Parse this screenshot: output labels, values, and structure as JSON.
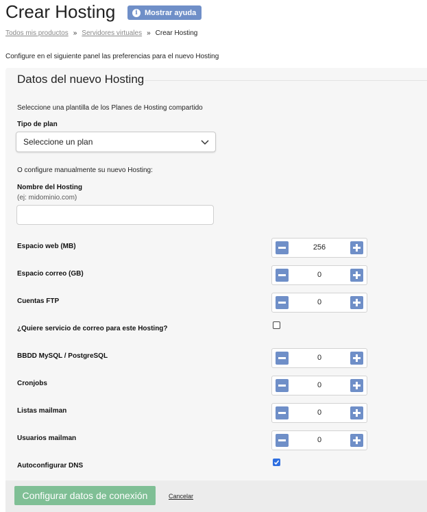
{
  "header": {
    "title": "Crear Hosting",
    "help_button": "Mostrar ayuda"
  },
  "breadcrumb": {
    "items": [
      "Todos mis productos",
      "Servidores virtuales",
      "Crear Hosting"
    ],
    "separator": "»"
  },
  "intro": "Configure en el siguiente panel las preferencias para el nuevo Hosting",
  "panel": {
    "title": "Datos del nuevo Hosting",
    "template_hint": "Seleccione una plantilla de los Planes de Hosting compartido",
    "plan_label": "Tipo de plan",
    "plan_select_value": "Seleccione un plan",
    "manual_hint": "O configure manualmente su nuevo Hosting:",
    "hosting_name_label": "Nombre del Hosting",
    "hosting_name_example": "(ej: midominio.com)",
    "hosting_name_value": ""
  },
  "fields": {
    "web_space": {
      "label": "Espacio web (MB)",
      "value": "256"
    },
    "mail_space": {
      "label": "Espacio correo (GB)",
      "value": "0"
    },
    "ftp_accounts": {
      "label": "Cuentas FTP",
      "value": "0"
    },
    "mail_service": {
      "label": "¿Quiere servicio de correo para este Hosting?",
      "checked": false
    },
    "databases": {
      "label": "BBDD MySQL / PostgreSQL",
      "value": "0"
    },
    "cronjobs": {
      "label": "Cronjobs",
      "value": "0"
    },
    "mailman_lists": {
      "label": "Listas mailman",
      "value": "0"
    },
    "mailman_users": {
      "label": "Usuarios mailman",
      "value": "0"
    },
    "auto_dns": {
      "label": "Autoconfigurar DNS",
      "checked": true
    }
  },
  "actions": {
    "submit": "Configurar datos de conexión",
    "cancel": "Cancelar"
  },
  "colors": {
    "accent": "#6f8fc8",
    "submit": "#7fbf95",
    "checkbox_on": "#2f6fe0",
    "panel_bg": "#f6f6f6"
  },
  "icons": {
    "help": "info-icon",
    "select": "chevron-down-icon",
    "stepper_dec": "minus-icon",
    "stepper_inc": "plus-icon",
    "check": "checkmark-icon"
  }
}
